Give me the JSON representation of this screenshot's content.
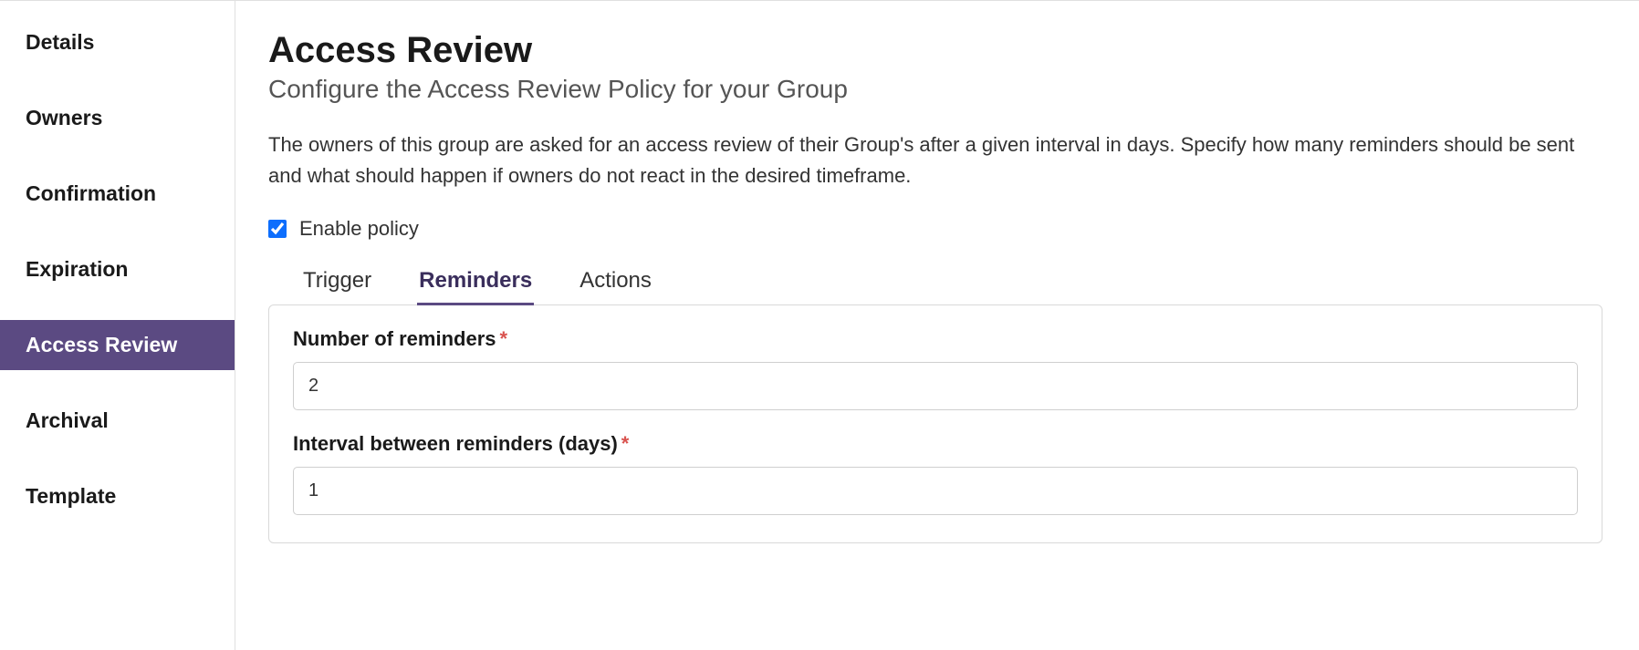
{
  "sidebar": {
    "items": [
      {
        "label": "Details"
      },
      {
        "label": "Owners"
      },
      {
        "label": "Confirmation"
      },
      {
        "label": "Expiration"
      },
      {
        "label": "Access Review"
      },
      {
        "label": "Archival"
      },
      {
        "label": "Template"
      }
    ],
    "activeIndex": 4
  },
  "main": {
    "title": "Access Review",
    "subtitle": "Configure the Access Review Policy for your Group",
    "description": "The owners of this group are asked for an access review of their Group's after a given interval in days. Specify how many reminders should be sent and what should happen if owners do not react in the desired timeframe.",
    "enable": {
      "label": "Enable policy",
      "checked": true
    },
    "tabs": [
      {
        "label": "Trigger"
      },
      {
        "label": "Reminders"
      },
      {
        "label": "Actions"
      }
    ],
    "activeTabIndex": 1,
    "form": {
      "numberOfReminders": {
        "label": "Number of reminders",
        "required": "*",
        "value": "2"
      },
      "intervalBetweenReminders": {
        "label": "Interval between reminders (days)",
        "required": "*",
        "value": "1"
      }
    }
  }
}
